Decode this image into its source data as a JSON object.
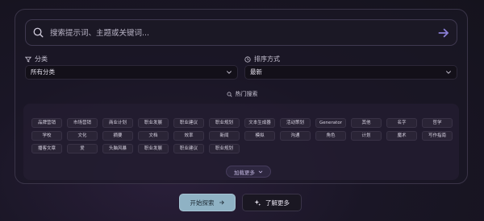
{
  "search": {
    "placeholder": "搜索提示词、主题或关键词...",
    "value": "",
    "submit_icon": "arrow-right-icon"
  },
  "filters": {
    "category_label": "分类",
    "category_icon": "filter-icon",
    "category_value": "所有分类",
    "sort_label": "排序方式",
    "sort_icon": "clock-icon",
    "sort_value": "最新"
  },
  "hot": {
    "title": "热门搜索",
    "icon": "search-icon",
    "tags": [
      "品牌营销",
      "市场营销",
      "商业计划",
      "职业发展",
      "职业建议",
      "职业规划",
      "文本生成器",
      "活动策划",
      "Generator",
      "其他",
      "名字",
      "哲学",
      "学校",
      "文化",
      "摘要",
      "文档",
      "效率",
      "新闻",
      "模拟",
      "沟通",
      "角色",
      "计划",
      "魔术",
      "写作指南",
      "播客文章",
      "爱",
      "头脑风暴",
      "职业发展",
      "职业建议",
      "职业规划"
    ],
    "more_label": "加载更多"
  },
  "actions": {
    "start_label": "开始探索",
    "learn_label": "了解更多"
  },
  "colors": {
    "accent": "#8b7fd6",
    "start_button": "#8fb2c4"
  }
}
